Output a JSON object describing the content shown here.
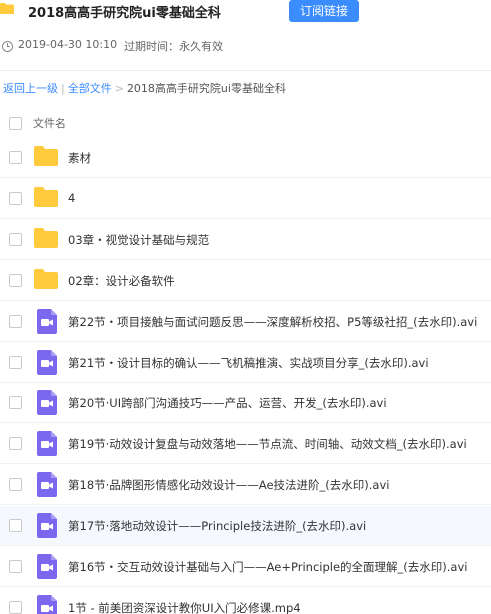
{
  "header": {
    "title": "2018高高手研究院ui零基础全科",
    "subscribe_label": "订阅链接"
  },
  "meta": {
    "date": "2019-04-30 10:10",
    "expire": "过期时间：永久有效"
  },
  "breadcrumb": {
    "back": "返回上一级",
    "sep1": "|",
    "all_files": "全部文件",
    "sep2": ">",
    "current": "2018高高手研究院ui零基础全科"
  },
  "list": {
    "column_name": "文件名",
    "items": [
      {
        "type": "folder",
        "name": "素材"
      },
      {
        "type": "folder",
        "name": "4"
      },
      {
        "type": "folder",
        "name": "03章・视觉设计基础与规范"
      },
      {
        "type": "folder",
        "name": "02章：设计必备软件"
      },
      {
        "type": "video",
        "name": "第22节・项目接触与面试问题反思——深度解析校招、P5等级社招_(去水印).avi"
      },
      {
        "type": "video",
        "name": "第21节・设计目标的确认——飞机稿推演、实战项目分享_(去水印).avi"
      },
      {
        "type": "video",
        "name": "第20节·UI跨部门沟通技巧——产品、运营、开发_(去水印).avi"
      },
      {
        "type": "video",
        "name": "第19节·动效设计复盘与动效落地——节点流、时间轴、动效文档_(去水印).avi"
      },
      {
        "type": "video",
        "name": "第18节·品牌图形情感化动效设计——Ae技法进阶_(去水印).avi"
      },
      {
        "type": "video",
        "name": "第17节·落地动效设计——Principle技法进阶_(去水印).avi"
      },
      {
        "type": "video",
        "name": "第16节・交互动效设计基础与入门——Ae+Principle的全面理解_(去水印).avi"
      },
      {
        "type": "video",
        "name": "1节 - 前美团资深设计教你UI入门必修课.mp4"
      }
    ]
  },
  "colors": {
    "accent": "#3b8cff",
    "folder": "#ffcb3c",
    "video": "#7b68ee"
  },
  "icons": {
    "folder": "folder-icon",
    "video": "video-file-icon",
    "clock": "clock-icon"
  }
}
